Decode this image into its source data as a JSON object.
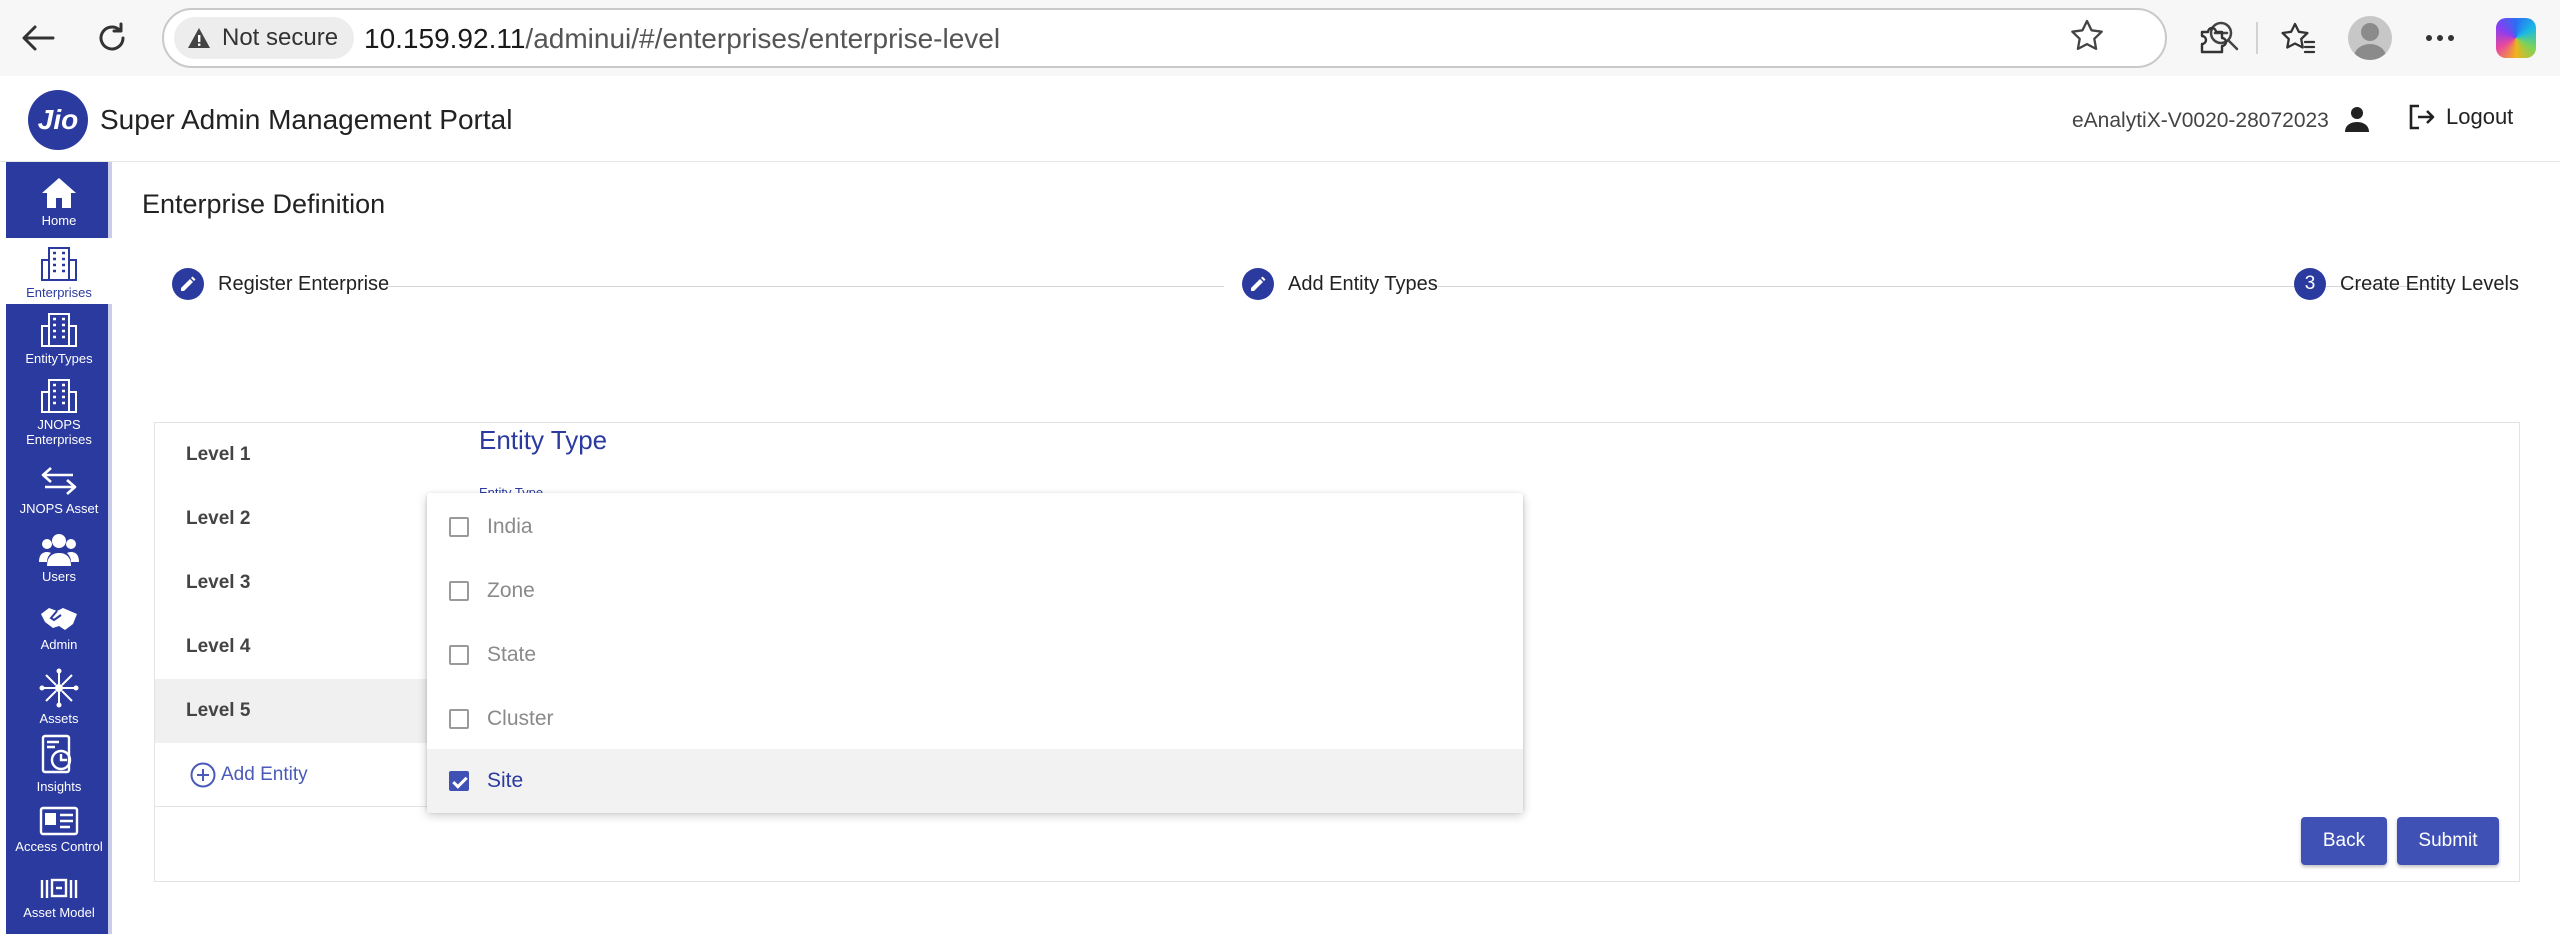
{
  "browser": {
    "security_label": "Not secure",
    "url_host": "10.159.92.11",
    "url_path": "/adminui/#/enterprises/enterprise-level"
  },
  "header": {
    "logo_text": "Jio",
    "title": "Super Admin Management Portal",
    "version": "eAnalytiX-V0020-28072023",
    "logout_label": "Logout"
  },
  "sidebar": {
    "items": [
      {
        "label": "Home",
        "icon": "home-icon"
      },
      {
        "label": "Enterprises",
        "icon": "building-icon"
      },
      {
        "label": "EntityTypes",
        "icon": "building-icon"
      },
      {
        "label": "JNOPS Enterprises",
        "icon": "building-icon"
      },
      {
        "label": "JNOPS Asset",
        "icon": "swap-arrows-icon"
      },
      {
        "label": "Users",
        "icon": "users-icon"
      },
      {
        "label": "Admin",
        "icon": "handshake-icon"
      },
      {
        "label": "Assets",
        "icon": "network-icon"
      },
      {
        "label": "Insights",
        "icon": "insights-icon"
      },
      {
        "label": "Access Control",
        "icon": "id-card-icon"
      },
      {
        "label": "Asset Model",
        "icon": "asset-model-icon"
      }
    ],
    "active_index": 1
  },
  "main": {
    "page_title": "Enterprise Definition",
    "steps": [
      {
        "label": "Register Enterprise",
        "marker": "edit-icon"
      },
      {
        "label": "Add Entity Types",
        "marker": "edit-icon"
      },
      {
        "label": "Create Entity Levels",
        "marker": "3"
      }
    ],
    "levels": [
      "Level 1",
      "Level 2",
      "Level 3",
      "Level 4",
      "Level 5"
    ],
    "selected_level_index": 4,
    "add_entity_label": "Add Entity",
    "entity_type_title": "Entity Type",
    "entity_type_field_label": "Entity Type",
    "back_label": "Back",
    "submit_label": "Submit"
  },
  "dropdown": {
    "options": [
      {
        "label": "India",
        "checked": false
      },
      {
        "label": "Zone",
        "checked": false
      },
      {
        "label": "State",
        "checked": false
      },
      {
        "label": "Cluster",
        "checked": false
      },
      {
        "label": "Site",
        "checked": true
      }
    ]
  },
  "colors": {
    "brand": "#2b3a9e",
    "button": "#3f51b5"
  }
}
